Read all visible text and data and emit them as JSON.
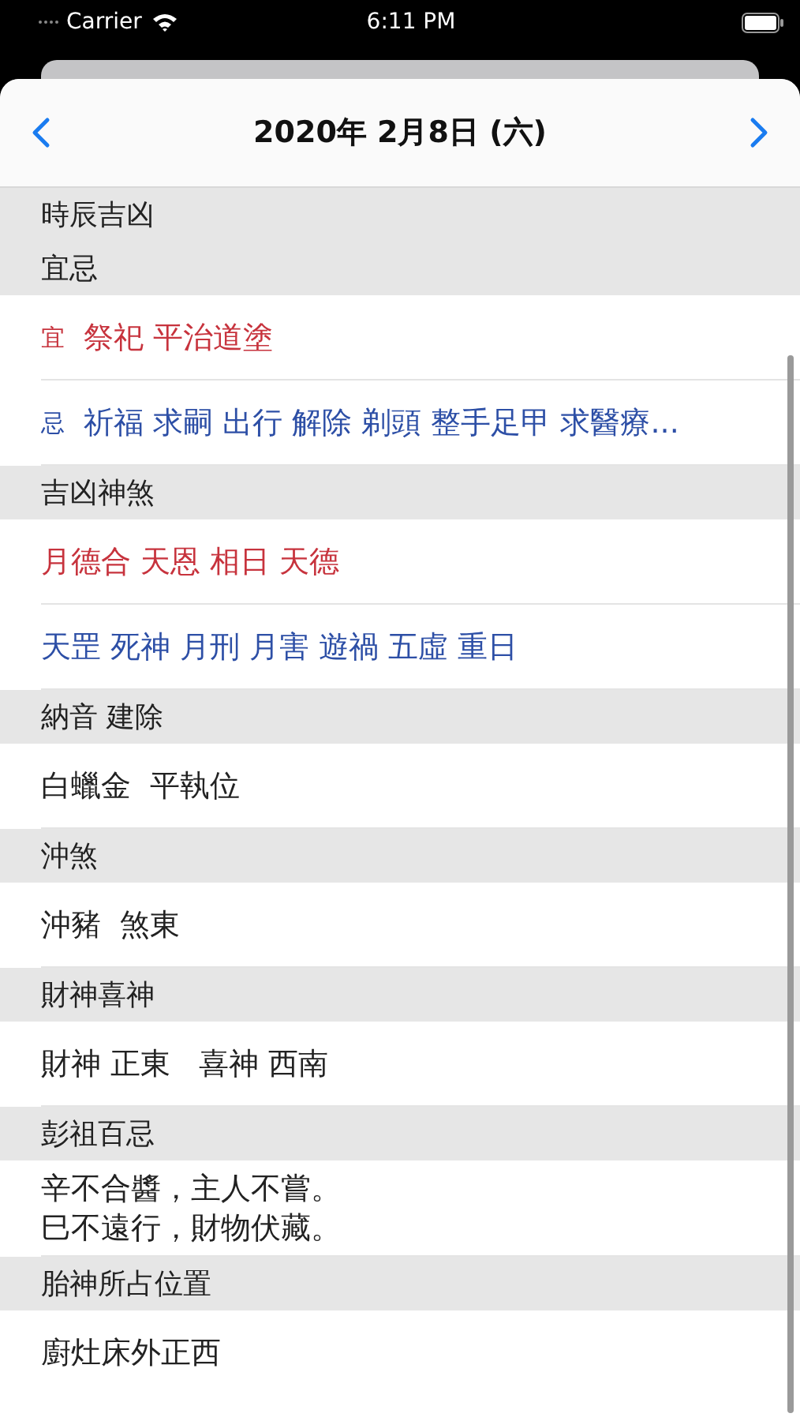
{
  "status_bar": {
    "carrier": "Carrier",
    "time": "6:11 PM"
  },
  "nav": {
    "title": "2020年 2月8日 (六)"
  },
  "sections": [
    {
      "title": "時辰吉凶"
    },
    {
      "title": "宜忌",
      "rows": [
        {
          "kind": "tagged",
          "tag": "宜",
          "text": "祭祀 平治道塗",
          "color": "#c7333d"
        },
        {
          "kind": "tagged",
          "tag": "忌",
          "text": "祈福 求嗣 出行 解除 剃頭 整手足甲 求醫療...",
          "color": "#2d4fa6"
        }
      ]
    },
    {
      "title": "吉凶神煞",
      "rows": [
        {
          "kind": "plain",
          "text": "月德合 天恩 相日 天德",
          "color": "#c7333d"
        },
        {
          "kind": "plain",
          "text": "天罡 死神 月刑 月害 遊禍 五虛 重日",
          "color": "#2d4fa6"
        }
      ]
    },
    {
      "title": "納音 建除",
      "rows": [
        {
          "kind": "plain",
          "text": "白蠟金  平執位",
          "color": "#222222"
        }
      ]
    },
    {
      "title": "沖煞",
      "rows": [
        {
          "kind": "plain",
          "text": "沖豬  煞東",
          "color": "#222222"
        }
      ]
    },
    {
      "title": "財神喜神",
      "rows": [
        {
          "kind": "plain",
          "text": "財神 正東   喜神 西南",
          "color": "#222222"
        }
      ]
    },
    {
      "title": "彭祖百忌",
      "rows": [
        {
          "kind": "multiline",
          "lines": [
            "辛不合醬，主人不嘗。",
            "巳不遠行，財物伏藏。"
          ],
          "color": "#222222"
        }
      ]
    },
    {
      "title": "胎神所占位置",
      "rows": [
        {
          "kind": "plain",
          "text": "廚灶床外正西",
          "color": "#222222"
        }
      ]
    }
  ]
}
